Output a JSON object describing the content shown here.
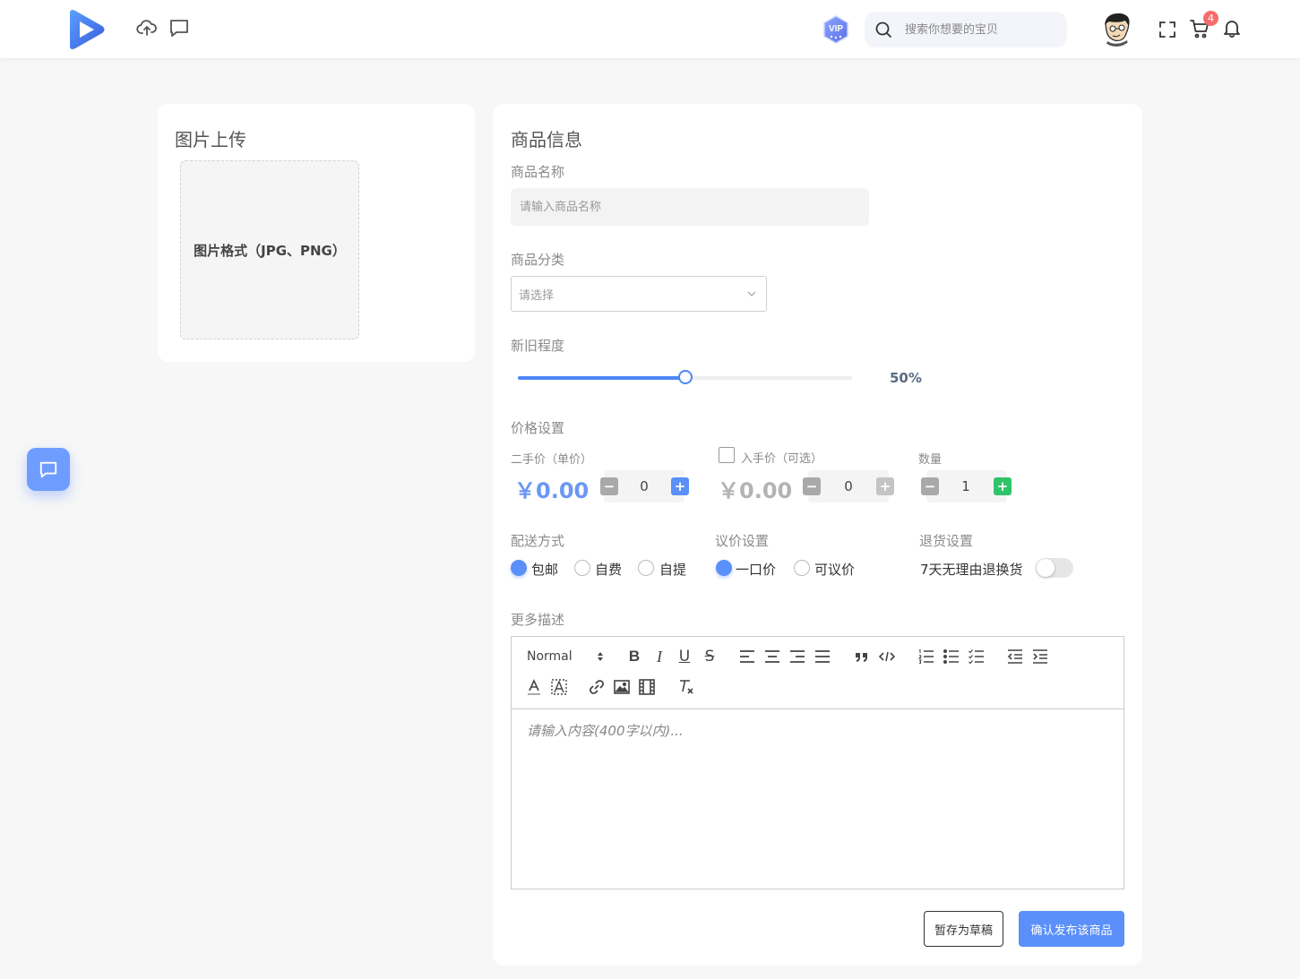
{
  "header": {
    "search_placeholder": "搜索你想要的宝贝",
    "vip_label": "VIP",
    "cart_count": "4"
  },
  "upload": {
    "title": "图片上传",
    "hint": "图片格式（JPG、PNG）"
  },
  "info": {
    "title": "商品信息",
    "name_label": "商品名称",
    "name_placeholder": "请输入商品名称",
    "category_label": "商品分类",
    "category_placeholder": "请选择",
    "condition_label": "新旧程度",
    "condition_value": "50%",
    "condition_fraction": 0.5,
    "price_section_label": "价格设置",
    "second_price_label": "二手价（单价）",
    "second_price": "￥0.00",
    "second_stepper": "0",
    "buy_price_label": "入手价（可选）",
    "buy_price": "￥0.00",
    "buy_stepper": "0",
    "qty_label": "数量",
    "qty_value": "1",
    "delivery_label": "配送方式",
    "delivery_options": [
      "包邮",
      "自费",
      "自提"
    ],
    "bargain_label": "议价设置",
    "bargain_options": [
      "一口价",
      "可议价"
    ],
    "return_label": "退货设置",
    "return_text": "7天无理由退换货",
    "desc_label": "更多描述",
    "editor_format": "Normal",
    "editor_placeholder": "请输入内容(400字以内)...",
    "draft_button": "暂存为草稿",
    "publish_button": "确认发布该商品"
  },
  "colors": {
    "accent": "#5b8ff9",
    "plus_green": "#2fc36a",
    "badge_red": "#f56c6c"
  }
}
